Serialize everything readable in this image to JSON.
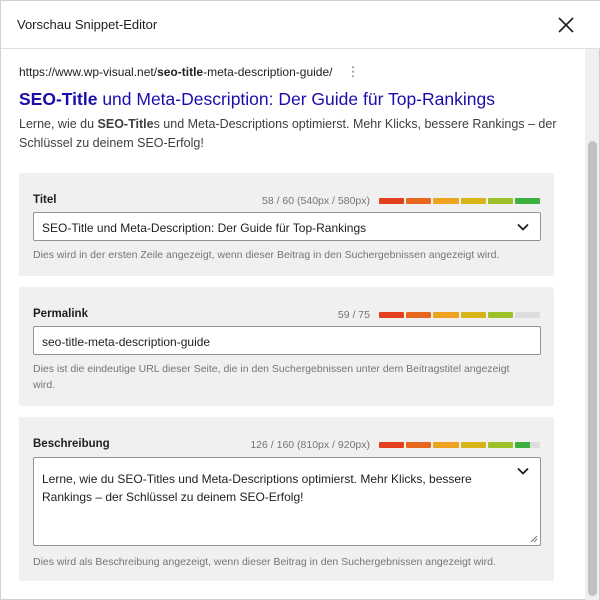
{
  "header": {
    "title": "Vorschau Snippet-Editor"
  },
  "preview": {
    "url_prefix": "https://www.wp-visual.net/",
    "url_bold": "seo-title",
    "url_suffix": "-meta-description-guide/",
    "dots": "⋮",
    "title_bold": "SEO-Title",
    "title_rest": " und Meta-Description: Der Guide für Top-Rankings",
    "desc_pre": "Lerne, wie du ",
    "desc_bold": "SEO-Title",
    "desc_rest": "s und Meta-Descriptions optimierst. Mehr Klicks, bessere Rankings – der Schlüssel zu deinem SEO-Erfolg!"
  },
  "title_box": {
    "label": "Titel",
    "counter": "58 / 60 (540px / 580px)",
    "value": "SEO-Title und Meta-Description: Der Guide für Top-Rankings",
    "help": "Dies wird in der ersten Zeile angezeigt, wenn dieser Beitrag in den Suchergebnissen angezeigt wird.",
    "meter_colors": [
      "#e2401c",
      "#e9661f",
      "#eda31f",
      "#d9b416",
      "#9cc028",
      "#3db13f"
    ]
  },
  "permalink_box": {
    "label": "Permalink",
    "counter": "59 / 75",
    "value": "seo-title-meta-description-guide",
    "help": "Dies ist die eindeutige URL dieser Seite, die in den Suchergebnissen unter dem Beitragstitel angezeigt wird.",
    "meter_colors": [
      "#e2401c",
      "#e9661f",
      "#eda31f",
      "#d9b416",
      "#9cc028",
      "#dddddd"
    ]
  },
  "description_box": {
    "label": "Beschreibung",
    "counter": "126 / 160 (810px / 920px)",
    "value": "Lerne, wie du SEO-Titles und Meta-Descriptions optimierst. Mehr Klicks, bessere Rankings – der Schlüssel zu deinem SEO-Erfolg!",
    "help": "Dies wird als Beschreibung angezeigt, wenn dieser Beitrag in den Suchergebnissen angezeigt wird.",
    "meter_colors": [
      "#e2401c",
      "#e9661f",
      "#eda31f",
      "#d9b416",
      "#9cc028",
      "#3db13f"
    ],
    "meter_last_fill": 0.6
  }
}
